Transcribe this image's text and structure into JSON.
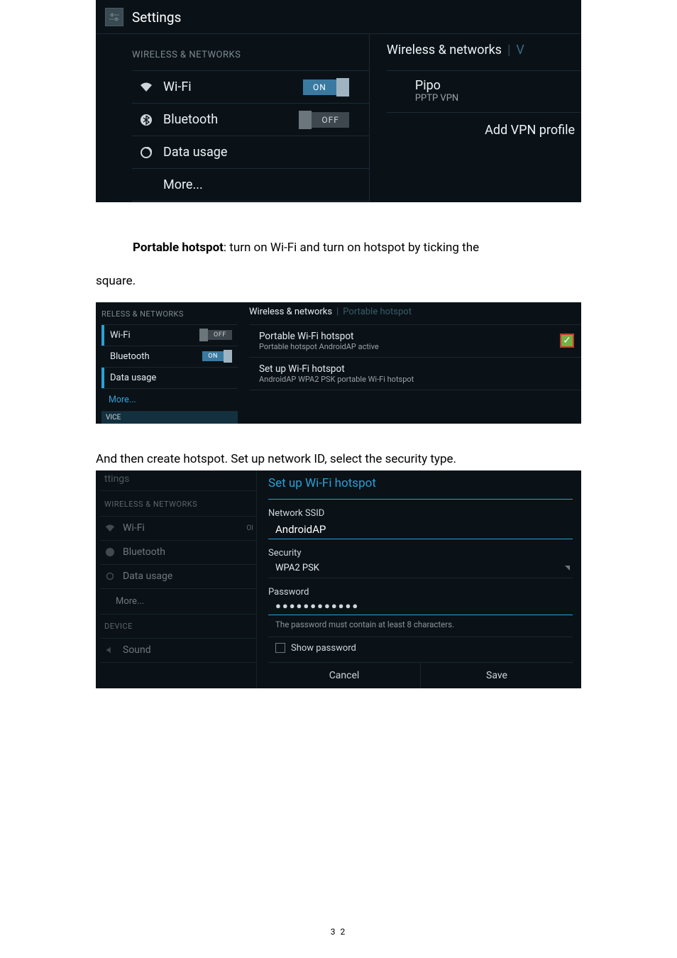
{
  "shot1": {
    "app_title": "Settings",
    "section_header": "WIRELESS & NETWORKS",
    "rows": {
      "wifi": {
        "label": "Wi-Fi",
        "toggle": "ON"
      },
      "bluetooth": {
        "label": "Bluetooth",
        "toggle": "OFF"
      },
      "datausage": {
        "label": "Data usage"
      },
      "more": {
        "label": "More..."
      }
    },
    "right": {
      "breadcrumb": "Wireless & networks",
      "breadcrumb_cut": "V",
      "vpn_name": "Pipo",
      "vpn_type": "PPTP VPN",
      "add_vpn": "Add VPN profile"
    }
  },
  "para1_prefix": "Portable hotspot",
  "para1_rest": ": turn on Wi-Fi and turn on hotspot by ticking the",
  "para1_line2": "square.",
  "shot2": {
    "section_header": "RELESS & NETWORKS",
    "wifi": {
      "label": "Wi-Fi",
      "toggle": "OFF"
    },
    "bluetooth": {
      "label": "Bluetooth",
      "toggle": "ON"
    },
    "datausage": {
      "label": "Data usage"
    },
    "more": {
      "label": "More..."
    },
    "vice": "VICE",
    "crumbs": {
      "a": "Wireless & networks",
      "b": "Portable hotspot"
    },
    "item1": {
      "title": "Portable Wi-Fi hotspot",
      "sub": "Portable hotspot AndroidAP active",
      "checked": "✓"
    },
    "item2": {
      "title": "Set up Wi-Fi hotspot",
      "sub": "AndroidAP WPA2 PSK portable Wi-Fi hotspot"
    }
  },
  "para2": "And then create hotspot. Set up network ID, select the security type.",
  "shot3": {
    "left_title": "ttings",
    "section_header": "WIRELESS & NETWORKS",
    "wifi": "Wi-Fi",
    "wifi_toggle_cut": "OI",
    "bluetooth": "Bluetooth",
    "datausage": "Data usage",
    "more": "More...",
    "device_header": "DEVICE",
    "sound": "Sound",
    "dialog": {
      "title": "Set up Wi-Fi hotspot",
      "ssid_label": "Network SSID",
      "ssid_value": "AndroidAP",
      "security_label": "Security",
      "security_value": "WPA2 PSK",
      "password_label": "Password",
      "password_dots": "●●●●●●●●●●●●",
      "hint": "The password must contain at least 8 characters.",
      "show_password": "Show password",
      "cancel": "Cancel",
      "save": "Save"
    }
  },
  "page_number": "3 2"
}
